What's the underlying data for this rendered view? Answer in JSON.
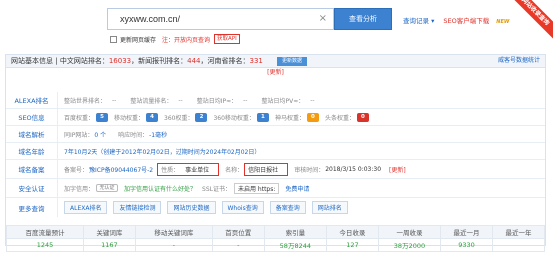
{
  "ribbon": "网站收录查询",
  "search": {
    "value": "xyxww.com.cn/",
    "clear": "×",
    "button": "查看分析"
  },
  "top_links": {
    "history": "查询记录 ▾",
    "seo_client": "SEO客户端下载",
    "new_badge": "NEW"
  },
  "options": {
    "checkbox_label": "更新网页缓存",
    "hint": "注：开放内页查询",
    "api": "获取API"
  },
  "header": {
    "title": "网站基本信息",
    "cn_rank_label": "中文网站排名：",
    "cn_rank": "16033",
    "news_rank_label": "新闻报刊排名：",
    "news_rank": "444",
    "province_rank_label": "河南省排名：",
    "province_rank": "331",
    "update_btn": "更新数据",
    "right_link": "威客号数据统计"
  },
  "refresh": "[更新]",
  "alexa": {
    "label": "ALEXA排名",
    "world": "整站世界排名：",
    "world_val": "--",
    "traffic": "整站流量排名：",
    "traffic_val": "--",
    "ip": "整站日均IP≈：",
    "ip_val": "--",
    "pv": "整站日均PV≈：",
    "pv_val": "--"
  },
  "seo": {
    "label": "SEO信息",
    "baidu_label": "百度权重：",
    "baidu_val": "5",
    "mobile_label": "移动权重：",
    "mobile_val": "4",
    "w360_label": "360权重：",
    "w360_val": "2",
    "m360_label": "360移动权重：",
    "m360_val": "1",
    "shenma_label": "神马权重：",
    "shenma_val": "0",
    "toutiao_label": "头条权重：",
    "toutiao_val": "0"
  },
  "domain_resolve": {
    "label": "域名解析",
    "ip_label": "同IP网站：",
    "ip_val": "0 个",
    "speed_label": "响应时间：",
    "speed_val": "-1毫秒"
  },
  "domain_age": {
    "label": "域名年龄",
    "text": "7年10月2天（创建于2012年02月02日，过期时间为2024年02月02日）"
  },
  "record": {
    "label": "域名备案",
    "no_label": "备案号：",
    "no_val": "豫ICP备09044067号-2",
    "nature_label": "性质：",
    "nature_val": "事业单位",
    "name_label": "名称：",
    "name_val": "信阳日报社",
    "time_label": "审核时间：",
    "time_val": "2018/3/15 0:03:30",
    "refresh": "[更新]"
  },
  "security": {
    "label": "安全认证",
    "cert_label": "加字信用：",
    "cert_icon": "无认证",
    "cert_text": "加字信用认证有什么好处？",
    "ssl_label": "SSL证书：",
    "https_btn": "未启用 https:",
    "free": "免费申请"
  },
  "more": {
    "label": "更多查询",
    "links": [
      "ALEXA排名",
      "友情链接检测",
      "网站历史数据",
      "Whois查询",
      "备案查询",
      "网站排名"
    ]
  },
  "stats": {
    "headers": [
      "百度流量预计",
      "关键词库",
      "移动关键词库",
      "首页位置",
      "索引量",
      "今日收录",
      "一周收录",
      "最近一月",
      "最近一年"
    ],
    "values": [
      "1245",
      "1167",
      "-",
      "-",
      "58万8244",
      "127",
      "38万2000",
      "9330",
      ""
    ]
  }
}
